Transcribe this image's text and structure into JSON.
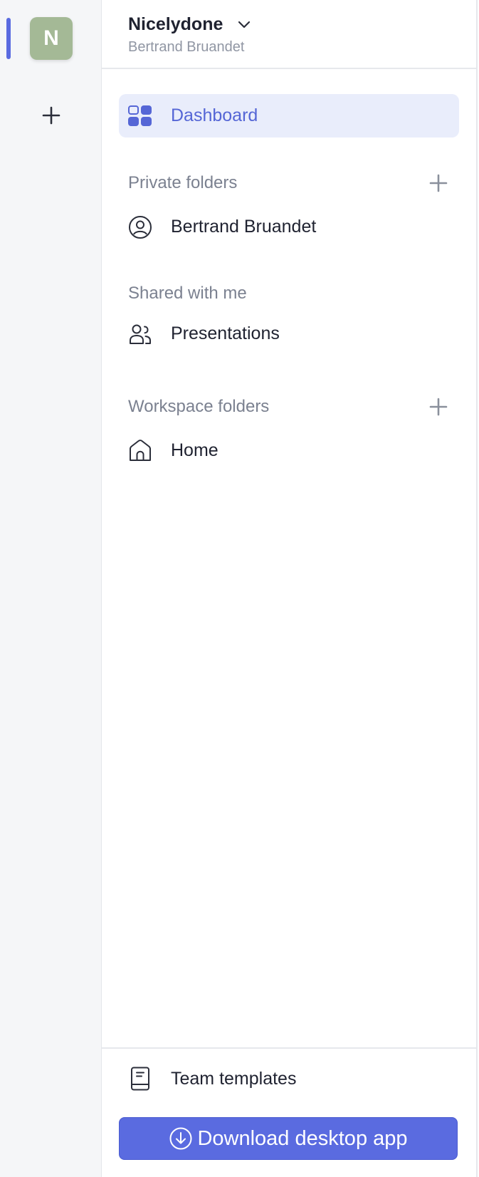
{
  "rail": {
    "workspace_initial": "N",
    "workspace_color": "#a4b996",
    "accent_color": "#5a6be0",
    "add_icon": "plus-icon"
  },
  "header": {
    "workspace_name": "Nicelydone",
    "user_name": "Bertrand Bruandet",
    "chevron_icon": "chevron-down-icon"
  },
  "nav": {
    "dashboard": {
      "label": "Dashboard",
      "icon": "dashboard-icon",
      "active": true
    },
    "private_folders": {
      "title": "Private folders",
      "items": [
        {
          "label": "Bertrand Bruandet",
          "icon": "user-circle-icon"
        }
      ]
    },
    "shared_with_me": {
      "title": "Shared with me",
      "items": [
        {
          "label": "Presentations",
          "icon": "users-icon"
        }
      ]
    },
    "workspace_folders": {
      "title": "Workspace folders",
      "items": [
        {
          "label": "Home",
          "icon": "home-icon"
        }
      ]
    }
  },
  "footer": {
    "templates_label": "Team templates",
    "templates_icon": "book-icon",
    "download_label": "Download desktop app",
    "download_icon": "download-circle-icon"
  }
}
